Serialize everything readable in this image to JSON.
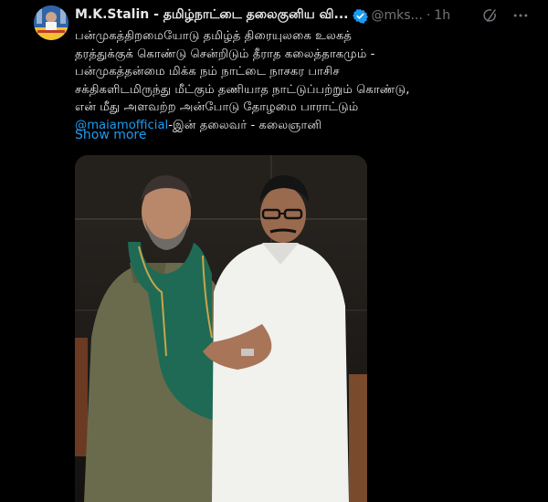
{
  "tweet": {
    "author_name": "M.K.Stalin - தமிழ்நாட்டை தலைகுனிய வி...",
    "handle": "@mks...",
    "separator": "·",
    "time": "1h",
    "verified_color": "#1d9bf0",
    "text_lines": [
      "பன்முகத்திறமையோடு தமிழ்த் திரையுலகை உலகத்",
      "தரத்துக்குக் கொண்டு சென்றிடும் தீராத கலைத்தாகமும் -",
      "பன்முகத்தன்மை மிக்க நம் நாட்டை நாசகர பாசிச",
      "சக்திகளிடமிருந்து மீட்கும் தணியாத நாட்டுப்பற்றும் கொண்டு,",
      "என் மீது அளவற்ற அன்போடு தோழமை பாராட்டும்"
    ],
    "mention": "@maiamofficial",
    "last_line_rest": "-இன் தலைவர் - கலைஞானி",
    "show_more": "Show more",
    "link_color": "#1d9bf0",
    "icons": {
      "grok": "grok-icon",
      "more": "more-options-icon",
      "verified": "verified-badge-icon"
    }
  }
}
